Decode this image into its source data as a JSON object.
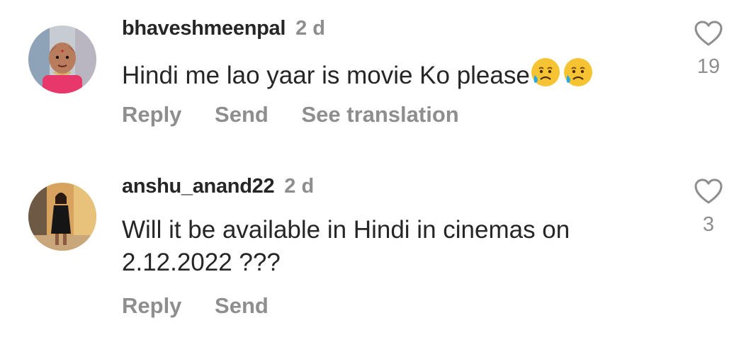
{
  "comments": [
    {
      "username": "bhaveshmeenpal",
      "time": "2 d",
      "text": "Hindi me lao yaar is movie Ko please",
      "emoji": [
        "crying-face",
        "crying-face"
      ],
      "likes": "19",
      "actions": [
        "Reply",
        "Send",
        "See translation"
      ]
    },
    {
      "username": "anshu_anand22",
      "time": "2 d",
      "text_line1": "Will it be available in Hindi in cinemas on",
      "text_line2": "2.12.2022 ???",
      "likes": "3",
      "actions": [
        "Reply",
        "Send"
      ]
    }
  ],
  "colors": {
    "primary_text": "#262626",
    "secondary_text": "#8e8e8e",
    "background": "#ffffff"
  },
  "icons": {
    "like": "heart-outline-icon",
    "emoji": "crying-face-emoji"
  }
}
